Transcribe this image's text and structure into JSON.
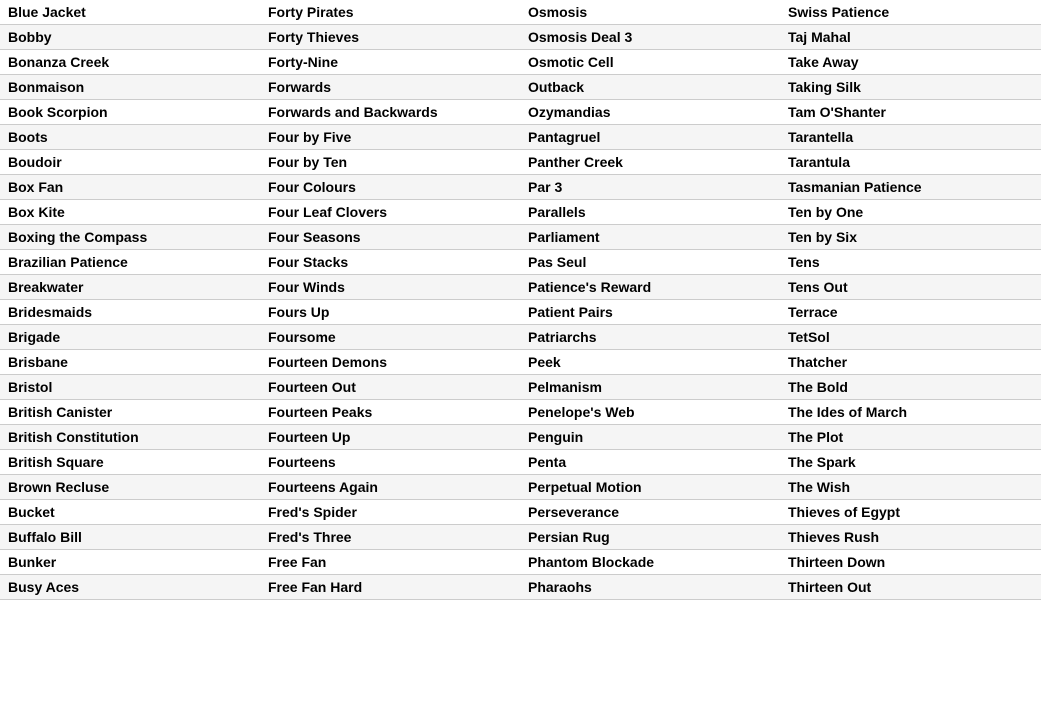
{
  "table": {
    "rows": [
      [
        "Blue Jacket",
        "Forty Pirates",
        "Osmosis",
        "Swiss Patience"
      ],
      [
        "Bobby",
        "Forty Thieves",
        "Osmosis Deal 3",
        "Taj Mahal"
      ],
      [
        "Bonanza Creek",
        "Forty-Nine",
        "Osmotic Cell",
        "Take Away"
      ],
      [
        "Bonmaison",
        "Forwards",
        "Outback",
        "Taking Silk"
      ],
      [
        "Book Scorpion",
        "Forwards and Backwards",
        "Ozymandias",
        "Tam O'Shanter"
      ],
      [
        "Boots",
        "Four by Five",
        "Pantagruel",
        "Tarantella"
      ],
      [
        "Boudoir",
        "Four by Ten",
        "Panther Creek",
        "Tarantula"
      ],
      [
        "Box Fan",
        "Four Colours",
        "Par 3",
        "Tasmanian Patience"
      ],
      [
        "Box Kite",
        "Four Leaf Clovers",
        "Parallels",
        "Ten by One"
      ],
      [
        "Boxing the Compass",
        "Four Seasons",
        "Parliament",
        "Ten by Six"
      ],
      [
        "Brazilian Patience",
        "Four Stacks",
        "Pas Seul",
        "Tens"
      ],
      [
        "Breakwater",
        "Four Winds",
        "Patience's Reward",
        "Tens Out"
      ],
      [
        "Bridesmaids",
        "Fours Up",
        "Patient Pairs",
        "Terrace"
      ],
      [
        "Brigade",
        "Foursome",
        "Patriarchs",
        "TetSol"
      ],
      [
        "Brisbane",
        "Fourteen Demons",
        "Peek",
        "Thatcher"
      ],
      [
        "Bristol",
        "Fourteen Out",
        "Pelmanism",
        "The Bold"
      ],
      [
        "British Canister",
        "Fourteen Peaks",
        "Penelope's Web",
        "The Ides of March"
      ],
      [
        "British Constitution",
        "Fourteen Up",
        "Penguin",
        "The Plot"
      ],
      [
        "British Square",
        "Fourteens",
        "Penta",
        "The Spark"
      ],
      [
        "Brown Recluse",
        "Fourteens Again",
        "Perpetual Motion",
        "The Wish"
      ],
      [
        "Bucket",
        "Fred's Spider",
        "Perseverance",
        "Thieves of Egypt"
      ],
      [
        "Buffalo Bill",
        "Fred's Three",
        "Persian Rug",
        "Thieves Rush"
      ],
      [
        "Bunker",
        "Free Fan",
        "Phantom Blockade",
        "Thirteen Down"
      ],
      [
        "Busy Aces",
        "Free Fan Hard",
        "Pharaohs",
        "Thirteen Out"
      ]
    ]
  }
}
